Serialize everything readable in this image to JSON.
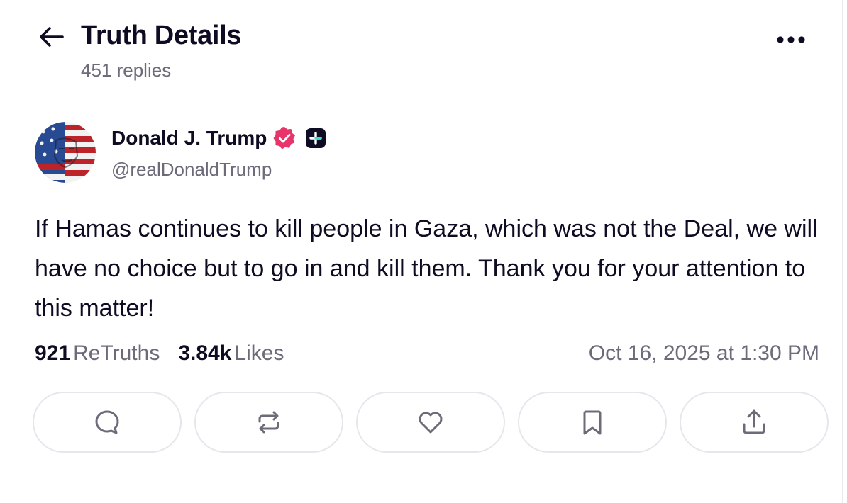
{
  "header": {
    "title": "Truth Details",
    "reply_count": "451 replies",
    "back_icon": "arrow-left-icon",
    "more_icon": "more-horizontal-icon"
  },
  "post": {
    "author": {
      "name": "Donald J. Trump",
      "handle": "@realDonaldTrump",
      "verified_icon": "verified-badge-icon",
      "plus_icon": "truth-plus-badge-icon"
    },
    "text": "If Hamas continues to kill people in Gaza, which was not the Deal, we will have no choice but to go in and kill them. Thank you for your attention to this matter!",
    "stats": {
      "retruths_count": "921",
      "retruths_label": "ReTruths",
      "likes_count": "3.84k",
      "likes_label": "Likes"
    },
    "timestamp": "Oct 16, 2025 at 1:30 PM"
  },
  "actions": [
    {
      "icon": "reply-icon"
    },
    {
      "icon": "retruth-icon"
    },
    {
      "icon": "like-icon"
    },
    {
      "icon": "bookmark-icon"
    },
    {
      "icon": "share-icon"
    }
  ],
  "colors": {
    "text_primary": "#0d0c22",
    "text_secondary": "#6b6b7a",
    "verified": "#e9336b",
    "plus_badge": "#0d0c22",
    "plus_accent": "#3ce0c8",
    "border": "#e6e6ec"
  }
}
